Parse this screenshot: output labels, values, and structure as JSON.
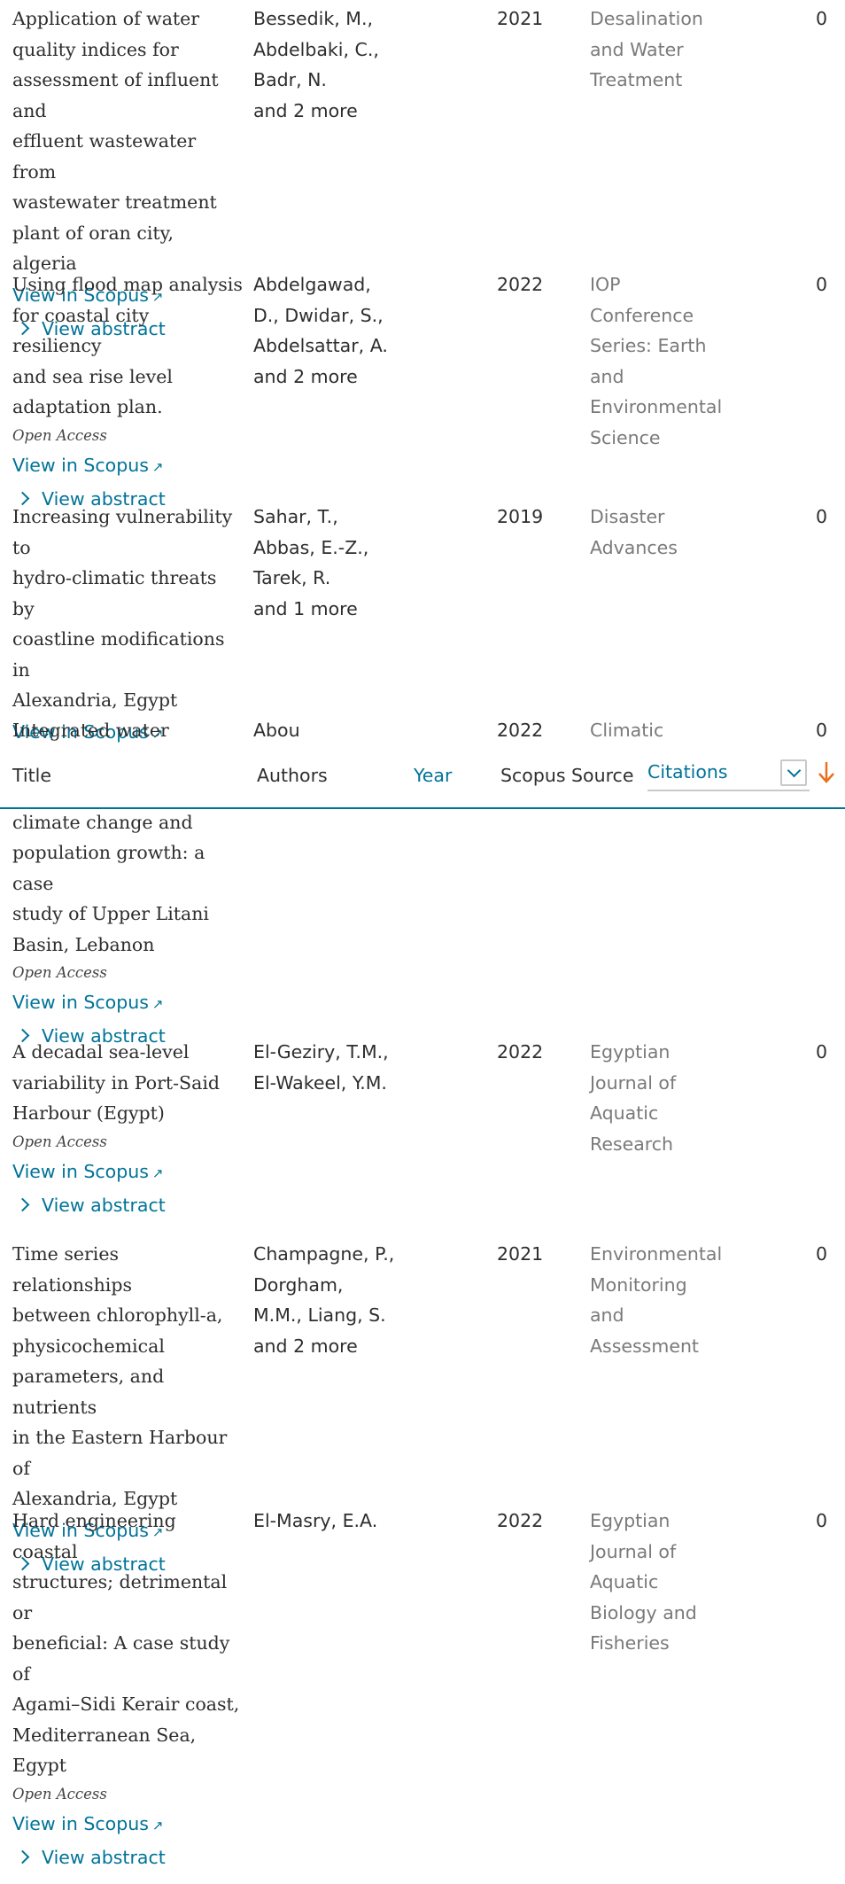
{
  "header": {
    "title": "Title",
    "authors": "Authors",
    "year": "Year",
    "source": "Scopus Source",
    "citations": "Citations"
  },
  "links": {
    "view_in_scopus": "View in Scopus",
    "view_abstract": "View abstract",
    "open_access": "Open Access"
  },
  "rows": [
    {
      "title": [
        "Application of water",
        "quality indices for",
        "assessment of influent and",
        "effluent wastewater from",
        "wastewater treatment",
        "plant of oran city, algeria"
      ],
      "authors": [
        "Bessedik, M.,",
        "Abdelbaki, C.,",
        "Badr, N.",
        "and 2 more"
      ],
      "year": "2021",
      "source": [
        "Desalination",
        "and Water",
        "Treatment"
      ],
      "citations": "0",
      "open_access": false
    },
    {
      "title": [
        "Using flood map analysis",
        "for coastal city resiliency",
        "and sea rise level",
        "adaptation plan."
      ],
      "authors": [
        "Abdelgawad,",
        "D., Dwidar, S.,",
        "Abdelsattar, A.",
        "and 2 more"
      ],
      "year": "2022",
      "source": [
        "IOP",
        "Conference",
        "Series: Earth",
        "and",
        "Environmental",
        "Science"
      ],
      "citations": "0",
      "open_access": true
    },
    {
      "title": [
        "Increasing vulnerability to",
        "hydro-climatic threats by",
        "coastline modifications in",
        "Alexandria, Egypt"
      ],
      "authors": [
        "Sahar, T.,",
        "Abbas, E.-Z.,",
        "Tarek, R.",
        "and 1 more"
      ],
      "year": "2019",
      "source": [
        "Disaster",
        "Advances"
      ],
      "citations": "0",
      "open_access": false
    },
    {
      "title": [
        "Integrated water balance",
        "",
        "climate change and",
        "population growth: a case",
        "study of Upper Litani",
        "Basin, Lebanon"
      ],
      "authors": [
        "Abou",
        ""
      ],
      "year": "2022",
      "source": [
        "Climatic",
        ""
      ],
      "citations": "0",
      "open_access": true
    },
    {
      "title": [
        "A decadal sea-level",
        "variability in Port-Said",
        "Harbour (Egypt)"
      ],
      "authors": [
        "El-Geziry, T.M.,",
        "El-Wakeel, Y.M."
      ],
      "year": "2022",
      "source": [
        "Egyptian",
        "Journal of",
        "Aquatic",
        "Research"
      ],
      "citations": "0",
      "open_access": true
    },
    {
      "title": [
        "Time series relationships",
        "between chlorophyll-a,",
        "physicochemical",
        "parameters, and nutrients",
        "in the Eastern Harbour of",
        "Alexandria, Egypt"
      ],
      "authors": [
        "Champagne, P.,",
        "Dorgham,",
        "M.M., Liang, S.",
        "and 2 more"
      ],
      "year": "2021",
      "source": [
        "Environmental",
        "Monitoring",
        "and",
        "Assessment"
      ],
      "citations": "0",
      "open_access": false
    },
    {
      "title": [
        "Hard engineering coastal",
        "structures; detrimental or",
        "beneficial: A case study of",
        "Agami–Sidi Kerair coast,",
        "Mediterranean Sea, Egypt"
      ],
      "authors": [
        "El-Masry, E.A."
      ],
      "year": "2022",
      "source": [
        "Egyptian",
        "Journal of",
        "Aquatic",
        "Biology and",
        "Fisheries"
      ],
      "citations": "0",
      "open_access": true
    }
  ],
  "colors": {
    "accent": "#007398",
    "sort_arrow": "#e9711c",
    "source_text": "#7a7a7a"
  },
  "icons": {
    "external_link": "external-link-icon",
    "chevron_right": "chevron-right-icon",
    "dropdown": "chevron-down-icon",
    "sort": "sort-descending-icon"
  }
}
